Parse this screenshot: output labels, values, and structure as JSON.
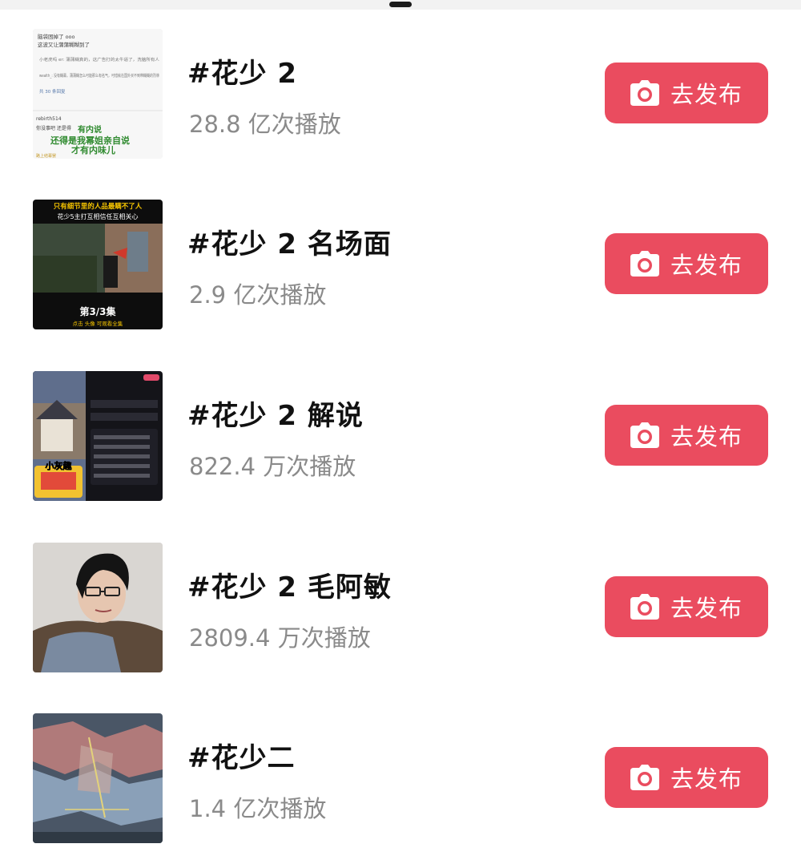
{
  "colors": {
    "accent": "#ea4c5f",
    "title": "#111111",
    "subtext": "#8a8a8a"
  },
  "topics": [
    {
      "title": "#花少 2",
      "plays": "28.8 亿次播放",
      "button_label": "去发布",
      "button_icon": "camera-icon",
      "thumb": {
        "kind": "comment-screenshot",
        "lines": [
          "脑袋困掉了 ooo",
          "这波又让蒲蒲糊糊到了",
          "小老虎吗 er: 蒲蒲糊真的，这广告打的太牛逼了，洗脑所有人",
          "wealth_: 没有糊幕，蒲蒲糊怎么可能那么有名气，可惜就在国外买不到带糊糊的烈林",
          "共 30 条回复",
          "rebirth514",
          "你没事吧 还是得",
          "有内说",
          "还得是我幂姐亲自说",
          "才有内味儿",
          "路上结幕罢"
        ]
      }
    },
    {
      "title": "#花少 2 名场面",
      "plays": "2.9 亿次播放",
      "button_label": "去发布",
      "button_icon": "camera-icon",
      "thumb": {
        "kind": "video-still",
        "lines": [
          "只有细节里的人品最瞒不了人",
          "花少5主打互相信任互相关心",
          "第3/3集",
          "点击 头像 可观看全集"
        ]
      }
    },
    {
      "title": "#花少 2 解说",
      "plays": "822.4 万次播放",
      "button_label": "去发布",
      "button_icon": "camera-icon",
      "thumb": {
        "kind": "app-screenshot",
        "lines": [
          "小灰趣"
        ]
      }
    },
    {
      "title": "#花少 2 毛阿敏",
      "plays": "2809.4 万次播放",
      "button_label": "去发布",
      "button_icon": "camera-icon",
      "thumb": {
        "kind": "portrait",
        "lines": []
      }
    },
    {
      "title": "#花少二",
      "plays": "1.4 亿次播放",
      "button_label": "去发布",
      "button_icon": "camera-icon",
      "thumb": {
        "kind": "map-still",
        "lines": []
      }
    }
  ]
}
